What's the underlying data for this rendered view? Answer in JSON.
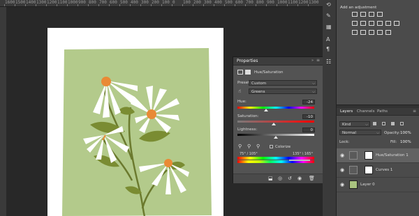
{
  "ruler": {
    "ticks": [
      "1600",
      "1500",
      "1400",
      "1300",
      "1200",
      "1100",
      "1000",
      "900",
      "800",
      "700",
      "600",
      "500",
      "400",
      "300",
      "200",
      "100",
      "0",
      "100",
      "200",
      "300",
      "400",
      "500",
      "600",
      "700",
      "800",
      "900",
      "1000",
      "1100",
      "1200",
      "1300"
    ]
  },
  "properties": {
    "tab_label": "Properties",
    "layer_type": "Hue/Saturation",
    "preset_label": "Preset:",
    "preset_value": "Custom",
    "channel_value": "Greens",
    "hue_label": "Hue:",
    "hue_value": "-24",
    "saturation_label": "Saturation:",
    "saturation_value": "-10",
    "lightness_label": "Lightness:",
    "lightness_value": "0",
    "colorize_label": "Colorize",
    "range_left": "75° / 105°",
    "range_right": "135° \\ 165°"
  },
  "adjustments": {
    "title": "Add an adjustment"
  },
  "layers": {
    "tabs": [
      "Layers",
      "Channels",
      "Paths"
    ],
    "kind_label": "Kind",
    "blend_mode": "Normal",
    "opacity_label": "Opacity:",
    "opacity_value": "100%",
    "lock_label": "Lock:",
    "fill_label": "Fill:",
    "fill_value": "100%",
    "items": [
      {
        "name": "Hue/Saturation 1"
      },
      {
        "name": "Curves 1"
      },
      {
        "name": "Layer 0"
      }
    ]
  }
}
